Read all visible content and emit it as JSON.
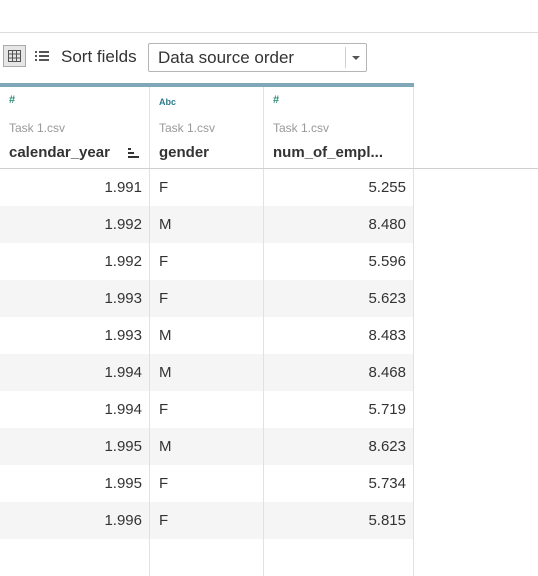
{
  "toolbar": {
    "sort_fields_label": "Sort fields",
    "sort_select_value": "Data source order",
    "grid_view_icon": "grid-icon",
    "list_view_icon": "list-icon"
  },
  "columns": [
    {
      "type_icon": "#",
      "source": "Task 1.csv",
      "name": "calendar_year",
      "has_sort_icon": true
    },
    {
      "type_icon": "Abc",
      "source": "Task 1.csv",
      "name": "gender",
      "has_sort_icon": false
    },
    {
      "type_icon": "#",
      "source": "Task 1.csv",
      "name": "num_of_empl...",
      "has_sort_icon": false
    }
  ],
  "rows": [
    {
      "year": "1.991",
      "gender": "F",
      "num": "5.255"
    },
    {
      "year": "1.992",
      "gender": "M",
      "num": "8.480"
    },
    {
      "year": "1.992",
      "gender": "F",
      "num": "5.596"
    },
    {
      "year": "1.993",
      "gender": "F",
      "num": "5.623"
    },
    {
      "year": "1.993",
      "gender": "M",
      "num": "8.483"
    },
    {
      "year": "1.994",
      "gender": "M",
      "num": "8.468"
    },
    {
      "year": "1.994",
      "gender": "F",
      "num": "5.719"
    },
    {
      "year": "1.995",
      "gender": "M",
      "num": "8.623"
    },
    {
      "year": "1.995",
      "gender": "F",
      "num": "5.734"
    },
    {
      "year": "1.996",
      "gender": "F",
      "num": "5.815"
    },
    {
      "year": "",
      "gender": "",
      "num": ""
    }
  ],
  "colors": {
    "header_accent": "#7fa7b8",
    "number_type_icon": "#2e8b7a",
    "alt_row": "#f5f5f5"
  }
}
